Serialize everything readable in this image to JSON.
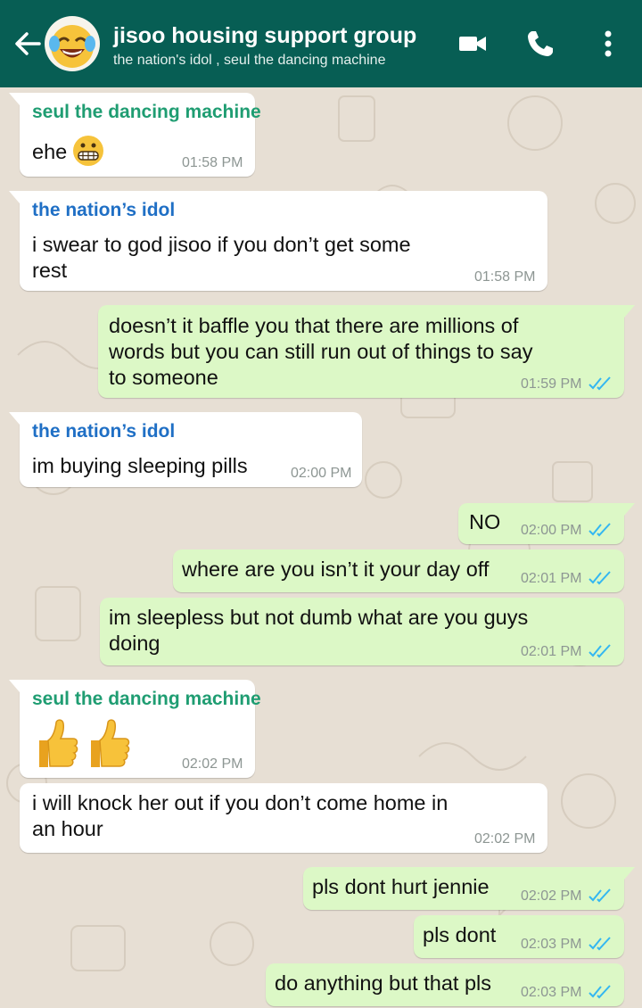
{
  "header": {
    "title": "jisoo housing support group",
    "subtitle": "the nation's idol , seul the dancing machine"
  },
  "messages": [
    {
      "sender": "seul the dancing machine",
      "text": "ehe",
      "emoji": "grimacing-face",
      "time": "01:58 PM"
    },
    {
      "sender": "the nation’s idol",
      "text_lines": [
        "i swear to god jisoo if you don’t get some",
        "rest"
      ],
      "time": "01:58 PM"
    },
    {
      "text_lines": [
        "doesn’t it baffle you that there are millions of",
        "words but you can still run out of things to say",
        "to someone"
      ],
      "time": "01:59 PM",
      "status": "read"
    },
    {
      "sender": "the nation’s idol",
      "text": "im buying sleeping pills",
      "time": "02:00 PM"
    },
    {
      "text": "NO",
      "time": "02:00 PM",
      "status": "read"
    },
    {
      "text": "where are you isn’t it your day off",
      "time": "02:01 PM",
      "status": "read"
    },
    {
      "text_lines": [
        "im sleepless but not dumb what are you guys",
        "doing"
      ],
      "time": "02:01 PM",
      "status": "read"
    },
    {
      "sender": "seul the dancing machine",
      "emoji": "thumbs-up x2",
      "time": "02:02 PM"
    },
    {
      "text_lines": [
        "i will knock her out if you don’t come home in",
        "an hour"
      ],
      "time": "02:02 PM"
    },
    {
      "text": "pls dont hurt jennie",
      "time": "02:02 PM",
      "status": "read"
    },
    {
      "text": "pls dont",
      "time": "02:03 PM",
      "status": "read"
    },
    {
      "text": "do anything but that pls",
      "time": "02:03 PM",
      "status": "read"
    }
  ],
  "colors": {
    "header_bg": "#075e54",
    "wallpaper": "#e7dfd4",
    "incoming_bubble": "#ffffff",
    "outgoing_bubble": "#dcf8c6",
    "sender_seul": "#1f9d72",
    "sender_idol": "#1f6fc5",
    "read_ticks": "#34b7f1"
  },
  "icons": {
    "back": "arrow-left-icon",
    "video": "video-call-icon",
    "call": "phone-icon",
    "menu": "more-vert-icon",
    "read": "double-check-icon"
  }
}
